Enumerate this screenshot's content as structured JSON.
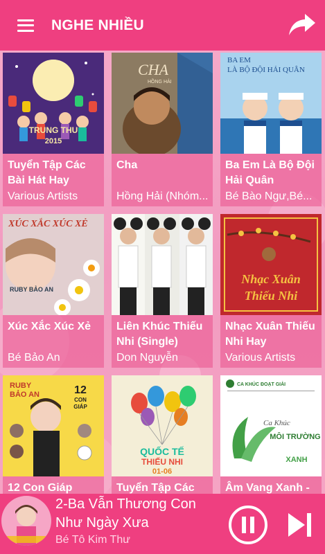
{
  "header": {
    "title": "NGHE NHIỀU",
    "menu_icon": "hamburger-menu-icon",
    "share_icon": "share-arrow-icon"
  },
  "colors": {
    "primary": "#ef3f80",
    "background": "#f48fb1"
  },
  "albums": [
    {
      "name": "Tuyển Tập Các Bài Hát Hay",
      "artist": "Various Artists",
      "cover_text": "TRUNG THU 2015"
    },
    {
      "name": "Cha",
      "artist": "Hồng Hải (Nhóm...",
      "cover_text": "CHA HỒNG HẢI"
    },
    {
      "name": "Ba Em Là Bộ Đội Hải Quân",
      "artist": "Bé Bào Ngư,Bé...",
      "cover_text": "BA EM LÀ BỘ ĐỘI HẢI QUÂN"
    },
    {
      "name": "Xúc Xắc Xúc Xẻ",
      "artist": "Bé Bảo An",
      "cover_text": "XÚC XẮC XÚC XẺ"
    },
    {
      "name": "Liên Khúc Thiếu Nhi (Single)",
      "artist": "Don Nguyễn",
      "cover_text": ""
    },
    {
      "name": "Nhạc Xuân Thiếu Nhi Hay",
      "artist": "Various Artists",
      "cover_text": "Nhạc Xuân Thiếu Nhi"
    },
    {
      "name": "12 Con Giáp",
      "artist": "",
      "cover_text": "RUBY BẢO AN 12 CON GIÁP"
    },
    {
      "name": "Tuyển Tập Các",
      "artist": "",
      "cover_text": "QUỐC TẾ THIẾU NHI 01-06"
    },
    {
      "name": "Âm Vang Xanh -",
      "artist": "",
      "cover_text": "Ca Khúc MÔI TRƯỜNG"
    }
  ],
  "player": {
    "song": "2-Ba Vẫn Thương Con Như Ngày Xưa",
    "singer": "Bé Tô Kim Thư",
    "pause_icon": "pause-icon",
    "next_icon": "skip-next-icon"
  }
}
